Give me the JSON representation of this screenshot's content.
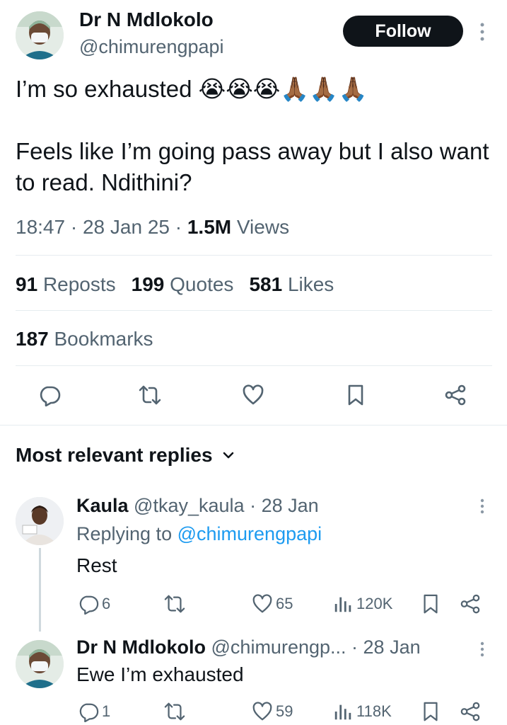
{
  "tweet": {
    "author_name": "Dr N Mdlokolo",
    "author_handle": "@chimurengpapi",
    "follow_label": "Follow",
    "text": "I’m so exhausted 😭😭😭🙏🏾🙏🏾🙏🏾\n\nFeels like I’m going pass away but I also want to read. Ndithini?",
    "time": "18:47",
    "date": "28 Jan 25",
    "views_count": "1.5M",
    "views_label": "Views",
    "reposts_count": "91",
    "reposts_label": "Reposts",
    "quotes_count": "199",
    "quotes_label": "Quotes",
    "likes_count": "581",
    "likes_label": "Likes",
    "bookmarks_count": "187",
    "bookmarks_label": "Bookmarks"
  },
  "actions": [
    "reply-icon",
    "repost-icon",
    "like-icon",
    "bookmark-icon",
    "share-icon"
  ],
  "replies_section": {
    "title": "Most relevant replies"
  },
  "replies": [
    {
      "name": "Kaula",
      "handle": "@tkay_kaula",
      "date": "28 Jan",
      "replying_prefix": "Replying to",
      "replying_to": "@chimurengpapi",
      "text": "Rest",
      "replies": "6",
      "reposts": "",
      "likes": "65",
      "views": "120K"
    },
    {
      "name": "Dr N Mdlokolo",
      "handle": "@chimurengp...",
      "date": "28 Jan",
      "text": "Ewe I’m exhausted",
      "replies": "1",
      "reposts": "",
      "likes": "59",
      "views": "118K"
    }
  ],
  "colors": {
    "text": "#0f1419",
    "secondary": "#536471",
    "link": "#1d9bf0",
    "divider": "#e6ecf0"
  }
}
